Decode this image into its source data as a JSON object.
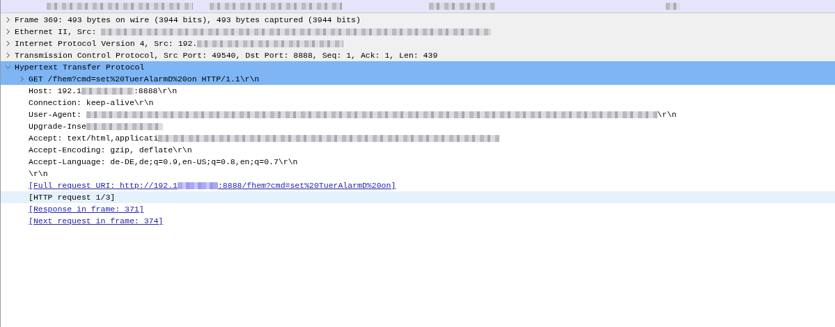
{
  "packet_list": {
    "rows": [
      {
        "kind": "redacted",
        "selected": true
      }
    ]
  },
  "tree": [
    {
      "kind": "node",
      "expanded": false,
      "selected": false,
      "parts": [
        {
          "kind": "text",
          "text": "Frame 369: 493 bytes on wire (3944 bits), 493 bytes captured (3944 bits)"
        }
      ]
    },
    {
      "kind": "node",
      "expanded": false,
      "selected": false,
      "parts": [
        {
          "kind": "text",
          "text": "Ethernet II, Src: "
        },
        {
          "kind": "redacted"
        }
      ]
    },
    {
      "kind": "node",
      "expanded": false,
      "selected": false,
      "parts": [
        {
          "kind": "text",
          "text": "Internet Protocol Version 4, Src: 192."
        },
        {
          "kind": "redacted"
        }
      ]
    },
    {
      "kind": "node",
      "expanded": false,
      "selected": false,
      "parts": [
        {
          "kind": "text",
          "text": "Transmission Control Protocol, Src Port: 49540, Dst Port: 8888, Seq: 1, Ack: 1, Len: 439"
        }
      ]
    },
    {
      "kind": "node",
      "expanded": true,
      "selected": true,
      "parts": [
        {
          "kind": "text",
          "text": "Hypertext Transfer Protocol"
        }
      ],
      "children": [
        {
          "kind": "node",
          "expanded": false,
          "selected": true,
          "hovered": false,
          "parts": [
            {
              "kind": "text",
              "text": "GET /fhem?cmd=set%20TuerAlarmD%20on HTTP/1.1\\r\\n"
            }
          ]
        },
        {
          "kind": "field",
          "selected": false,
          "hovered": false,
          "parts": [
            {
              "kind": "text",
              "text": "Host: 192.1"
            },
            {
              "kind": "redacted"
            },
            {
              "kind": "text",
              "text": ":8888\\r\\n"
            }
          ]
        },
        {
          "kind": "field",
          "selected": false,
          "hovered": false,
          "parts": [
            {
              "kind": "text",
              "text": "Connection: keep-alive\\r\\n"
            }
          ]
        },
        {
          "kind": "field",
          "selected": false,
          "hovered": false,
          "parts": [
            {
              "kind": "text",
              "text": "User-Agent: "
            },
            {
              "kind": "redacted"
            },
            {
              "kind": "text",
              "text": "\\r\\n"
            }
          ]
        },
        {
          "kind": "field",
          "selected": false,
          "hovered": false,
          "parts": [
            {
              "kind": "text",
              "text": "Upgrade-Inse"
            },
            {
              "kind": "redacted"
            }
          ]
        },
        {
          "kind": "field",
          "selected": false,
          "hovered": false,
          "parts": [
            {
              "kind": "text",
              "text": "Accept: text/html,applicati"
            },
            {
              "kind": "redacted"
            }
          ]
        },
        {
          "kind": "field",
          "selected": false,
          "hovered": false,
          "parts": [
            {
              "kind": "text",
              "text": "Accept-Encoding: gzip, deflate\\r\\n"
            }
          ]
        },
        {
          "kind": "field",
          "selected": false,
          "hovered": false,
          "parts": [
            {
              "kind": "text",
              "text": "Accept-Language: de-DE,de;q=0.9,en-US;q=0.8,en;q=0.7\\r\\n"
            }
          ]
        },
        {
          "kind": "field",
          "selected": false,
          "hovered": false,
          "parts": [
            {
              "kind": "text",
              "text": "\\r\\n"
            }
          ]
        },
        {
          "kind": "link",
          "selected": false,
          "hovered": false,
          "parts": [
            {
              "kind": "text",
              "text": "[Full request URI: http://192.1"
            },
            {
              "kind": "redacted"
            },
            {
              "kind": "text",
              "text": ":8888/fhem?cmd=set%20TuerAlarmD%20on]"
            }
          ]
        },
        {
          "kind": "field",
          "selected": false,
          "hovered": true,
          "parts": [
            {
              "kind": "text",
              "text": "[HTTP request 1/3]"
            }
          ]
        },
        {
          "kind": "link",
          "selected": false,
          "hovered": false,
          "parts": [
            {
              "kind": "text",
              "text": "[Response in frame: 371]"
            }
          ]
        },
        {
          "kind": "link",
          "selected": false,
          "hovered": false,
          "parts": [
            {
              "kind": "text",
              "text": "[Next request in frame: 374]"
            }
          ]
        }
      ]
    }
  ]
}
